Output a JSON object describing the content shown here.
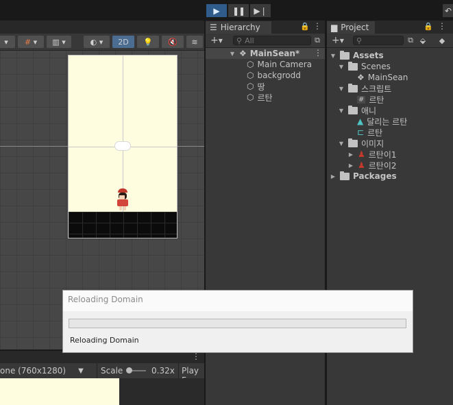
{
  "toolbar": {
    "play_icon": "play-icon",
    "pause_icon": "pause-icon",
    "step_icon": "step-icon",
    "right_icon": "undo-history-icon"
  },
  "scene_toolbar": {
    "mode_2d_label": "2D"
  },
  "game_bar": {
    "resolution": "one (760x1280)",
    "scale_label": "Scale",
    "scale_value": "0.32x",
    "play_label": "Play F"
  },
  "hierarchy": {
    "tab_label": "Hierarchy",
    "search_placeholder": "All",
    "scene_name": "MainSean*",
    "items": [
      "Main Camera",
      "backgrodd",
      "땅",
      "르탄"
    ]
  },
  "project": {
    "tab_label": "Project",
    "tree": {
      "assets": "Assets",
      "scenes": "Scenes",
      "scene_file": "MainSean",
      "scripts": "스크립트",
      "script_file": "르탄",
      "anim": "애니",
      "anim_clip": "달리는 르탄",
      "anim_controller": "르탄",
      "images": "이미지",
      "image1": "르탄이1",
      "image2": "르탄이2",
      "packages": "Packages"
    }
  },
  "dialog": {
    "title": "Reloading Domain",
    "status": "Reloading Domain",
    "progress": 0
  },
  "colors": {
    "accent": "#2f5c8a",
    "panel": "#383838",
    "game_bg": "#fefde0"
  }
}
